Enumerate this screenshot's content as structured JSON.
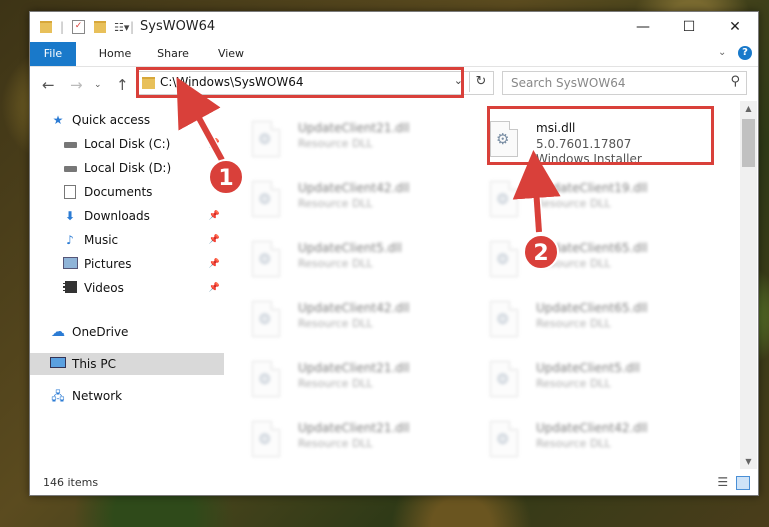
{
  "window": {
    "title": "SysWOW64",
    "controls": {
      "minimize": "—",
      "maximize": "☐",
      "close": "✕"
    }
  },
  "ribbon": {
    "tabs": [
      "File",
      "Home",
      "Share",
      "View"
    ]
  },
  "address": {
    "path": "C:\\Windows\\SysWOW64",
    "search_placeholder": "Search SysWOW64"
  },
  "nav": {
    "items": [
      {
        "label": "Quick access",
        "icon": "star-icon",
        "pinned": false
      },
      {
        "label": "Local Disk (C:)",
        "icon": "drive-icon",
        "pinned": true
      },
      {
        "label": "Local Disk (D:)",
        "icon": "drive-icon",
        "pinned": true
      },
      {
        "label": "Documents",
        "icon": "documents-icon",
        "pinned": true
      },
      {
        "label": "Downloads",
        "icon": "download-icon",
        "pinned": true
      },
      {
        "label": "Music",
        "icon": "music-icon",
        "pinned": true
      },
      {
        "label": "Pictures",
        "icon": "pictures-icon",
        "pinned": true
      },
      {
        "label": "Videos",
        "icon": "videos-icon",
        "pinned": true
      },
      {
        "label": "OneDrive",
        "icon": "cloud-icon",
        "pinned": false
      },
      {
        "label": "This PC",
        "icon": "pc-icon",
        "pinned": false
      },
      {
        "label": "Network",
        "icon": "network-icon",
        "pinned": false
      }
    ]
  },
  "files": {
    "highlighted": {
      "name": "msi.dll",
      "version": "5.0.7601.17807",
      "description": "Windows Installer"
    },
    "left": [
      {
        "name": "UpdateClient21.dll",
        "type": "Resource DLL"
      },
      {
        "name": "UpdateClient42.dll",
        "type": "Resource DLL"
      },
      {
        "name": "UpdateClient5.dll",
        "type": "Resource DLL"
      },
      {
        "name": "UpdateClient42.dll",
        "type": "Resource DLL"
      },
      {
        "name": "UpdateClient21.dll",
        "type": "Resource DLL"
      },
      {
        "name": "UpdateClient21.dll",
        "type": "Resource DLL"
      }
    ],
    "right": [
      {
        "name": "UpdateClient19.dll",
        "type": "Resource DLL"
      },
      {
        "name": "UpdateClient65.dll",
        "type": "Resource DLL"
      },
      {
        "name": "UpdateClient65.dll",
        "type": "Resource DLL"
      },
      {
        "name": "UpdateClient5.dll",
        "type": "Resource DLL"
      },
      {
        "name": "UpdateClient42.dll",
        "type": "Resource DLL"
      }
    ]
  },
  "status": {
    "item_count": "146 items"
  },
  "annotations": {
    "step1": "1",
    "step2": "2"
  },
  "colors": {
    "accent": "#1979ca",
    "annotation": "#d9403a"
  }
}
